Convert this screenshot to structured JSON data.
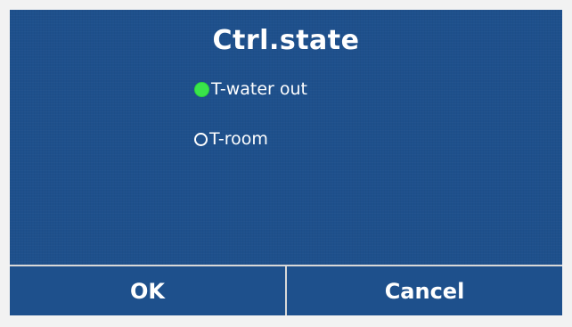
{
  "screen": {
    "title": "Ctrl.state",
    "options": [
      {
        "label": "T-water out",
        "selected": true
      },
      {
        "label": "T-room",
        "selected": false
      }
    ],
    "selected_color": "#39e54a",
    "background_color": "#1e508c"
  },
  "footer": {
    "ok_label": "OK",
    "cancel_label": "Cancel"
  }
}
